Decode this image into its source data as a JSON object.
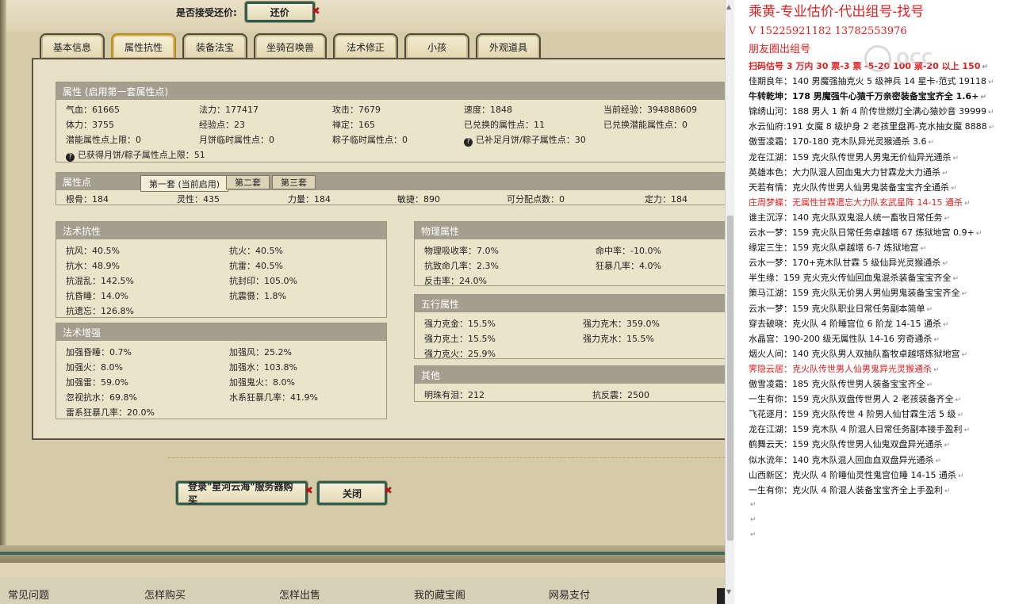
{
  "accept": {
    "label": "是否接受还价:",
    "button": "还价",
    "close_x": "✖"
  },
  "tabs": [
    "基本信息",
    "属性抗性",
    "装备法宝",
    "坐骑召唤兽",
    "法术修正",
    "小孩",
    "外观道具"
  ],
  "attr": {
    "head": "属性 (启用第一套属性点)",
    "rows": [
      [
        "气血：61665",
        "法力：177417",
        "攻击：7679",
        "速度：1848",
        "当前经验：394888609"
      ],
      [
        "体力：3755",
        "经验点：23",
        "禅定：165",
        "已兑换的属性点：11",
        "已兑换潜能属性点：0"
      ],
      [
        "潜能属性点上限：0",
        "月饼临时属性点：0",
        "粽子临时属性点：0",
        "已补足月饼/粽子属性点：30"
      ],
      [
        "已获得月饼/粽子属性点上限：51"
      ]
    ]
  },
  "points": {
    "head": "属性点",
    "subtabs": [
      "第一套 (当前启用)",
      "第二套",
      "第三套"
    ],
    "row": [
      "根骨：184",
      "灵性：435",
      "力量：184",
      "敏捷：890",
      "可分配点数：0",
      "定力：184"
    ]
  },
  "resist": {
    "head": "法术抗性",
    "rows": [
      [
        "抗风：40.5%",
        "抗火：40.5%"
      ],
      [
        "抗水：48.9%",
        "抗雷：40.5%"
      ],
      [
        "抗混乱：142.5%",
        "抗封印：105.0%"
      ],
      [
        "抗昏睡：14.0%",
        "抗震慑：1.8%"
      ],
      [
        "抗遗忘：126.8%",
        ""
      ]
    ]
  },
  "enhance": {
    "head": "法术增强",
    "rows": [
      [
        "加强昏睡：0.7%",
        "加强风：25.2%"
      ],
      [
        "加强火：8.0%",
        "加强水：103.8%"
      ],
      [
        "加强雷：59.0%",
        "加强鬼火：8.0%"
      ],
      [
        "忽视抗水：69.8%",
        "水系狂暴几率：41.9%"
      ],
      [
        "雷系狂暴几率：20.0%",
        ""
      ]
    ]
  },
  "physical": {
    "head": "物理属性",
    "rows": [
      [
        "物理吸收率：7.0%",
        "命中率：-10.0%"
      ],
      [
        "抗致命几率：2.3%",
        "狂暴几率：4.0%"
      ],
      [
        "反击率：24.0%",
        ""
      ]
    ]
  },
  "elements": {
    "head": "五行属性",
    "rows": [
      [
        "强力克金：15.5%",
        "强力克木：359.0%"
      ],
      [
        "强力克土：15.5%",
        "强力克水：15.5%"
      ],
      [
        "强力克火：25.9%",
        ""
      ]
    ]
  },
  "other": {
    "head": "其他",
    "rows": [
      [
        "明珠有泪：212",
        "抗反震：2500"
      ]
    ]
  },
  "buttons": {
    "login": "登录\"星河云海\"服务器购买",
    "close": "关闭",
    "x": "✖"
  },
  "footer": [
    "常见问题",
    "怎样购买",
    "怎样出售",
    "我的藏宝阁",
    "网易支付"
  ],
  "notes": [
    {
      "t": "乘黄-专业估价-代出组号-找号",
      "s": "big"
    },
    {
      "t": "V    15225921182    13782553976",
      "s": "med"
    },
    {
      "t": "朋友圈出组号",
      "s": "med"
    },
    {
      "t": "扫码估号 3 万内 30 票-3      票 -5-20 100 票-20 以上 150",
      "s": "red bold"
    },
    {
      "t": "佳期良年：140 男魔强抽克火 5 级神兵 14 星卡-范式 19118",
      "s": ""
    },
    {
      "t": "牛转乾坤：178 男魔强牛心猿千万亲密装备宝宝齐全 1.6+",
      "s": "bold"
    },
    {
      "t": "锦绣山河：188 男人 1 新 4 阶传世燃灯全满心猿妙音 39999",
      "s": ""
    },
    {
      "t": "水云仙府:191 女魔 8 级护身 2 老孩里盘再-克水抽女魔 8888",
      "s": ""
    },
    {
      "t": "傲雪凌霜：170-180 克木队异光灵猴通杀 3.6",
      "s": ""
    },
    {
      "t": "龙在江湖：159 克火队传世男人男鬼无价仙异光通杀",
      "s": ""
    },
    {
      "t": "英雄本色：大力队混人回血鬼大力甘霖龙大力通杀",
      "s": ""
    },
    {
      "t": "天若有情：克火队传世男人仙男鬼装备宝宝齐全通杀",
      "s": ""
    },
    {
      "t": "庄周梦蝶：无属性甘霖遗忘大力队玄武星阵 14-15 通杀",
      "s": "red"
    },
    {
      "t": "谁主沉浮：140 克火队双鬼混人统一畜牧日常任务",
      "s": ""
    },
    {
      "t": "云水一梦：159 克火队日常任务卓越塔 67 炼狱地宫 0.9+",
      "s": ""
    },
    {
      "t": "缘定三生：159 克火队卓越塔 6-7 炼狱地宫",
      "s": ""
    },
    {
      "t": "云水一梦：170+克木队甘霖 5 级仙异光灵猴通杀",
      "s": ""
    },
    {
      "t": "半生缘：159 克火克火传仙回血鬼混杀装备宝宝齐全",
      "s": ""
    },
    {
      "t": "策马江湖：159 克火队无价男人男仙男鬼装备宝宝齐全",
      "s": ""
    },
    {
      "t": "云水一梦：159 克火队职业日常任务副本简单",
      "s": ""
    },
    {
      "t": "穿去破晓：克火队 4 阶睡宫位 6 阶龙 14-15 通杀",
      "s": ""
    },
    {
      "t": "水晶宫：190-200 级无属性队 14-16 穷奇通杀",
      "s": ""
    },
    {
      "t": "烟火人间：140 克火队男人双抽队畜牧卓越塔炼狱地宫",
      "s": ""
    },
    {
      "t": "霁隐云居：克火队传世男人仙男鬼异光灵猴通杀",
      "s": "red"
    },
    {
      "t": "傲雪凌霜：185 克火队传世男人装备宝宝齐全",
      "s": ""
    },
    {
      "t": "一生有你：159 克火队双盘传世男人 2 老孩装备齐全",
      "s": ""
    },
    {
      "t": "飞花逐月：159 克火队传世 4 阶男人仙甘霖生活 5 级",
      "s": ""
    },
    {
      "t": "龙在江湖：159 克木队 4 阶混人日常任务副本接手盈利",
      "s": ""
    },
    {
      "t": "鹤舞云天：159 克火队传世男人仙鬼双盘异光通杀",
      "s": ""
    },
    {
      "t": "似水流年：140 克木队混人回血血双盘异光通杀",
      "s": ""
    },
    {
      "t": "山西新区：克火队 4 阶睡仙灵性鬼宫位睡 14-15 通杀",
      "s": ""
    },
    {
      "t": "一生有你：克火队 4 阶混人装备宝宝齐全上手盈利",
      "s": ""
    },
    {
      "t": "",
      "s": ""
    },
    {
      "t": "",
      "s": ""
    },
    {
      "t": "",
      "s": ""
    }
  ],
  "return_mark": "↵",
  "watermark": "OCC"
}
